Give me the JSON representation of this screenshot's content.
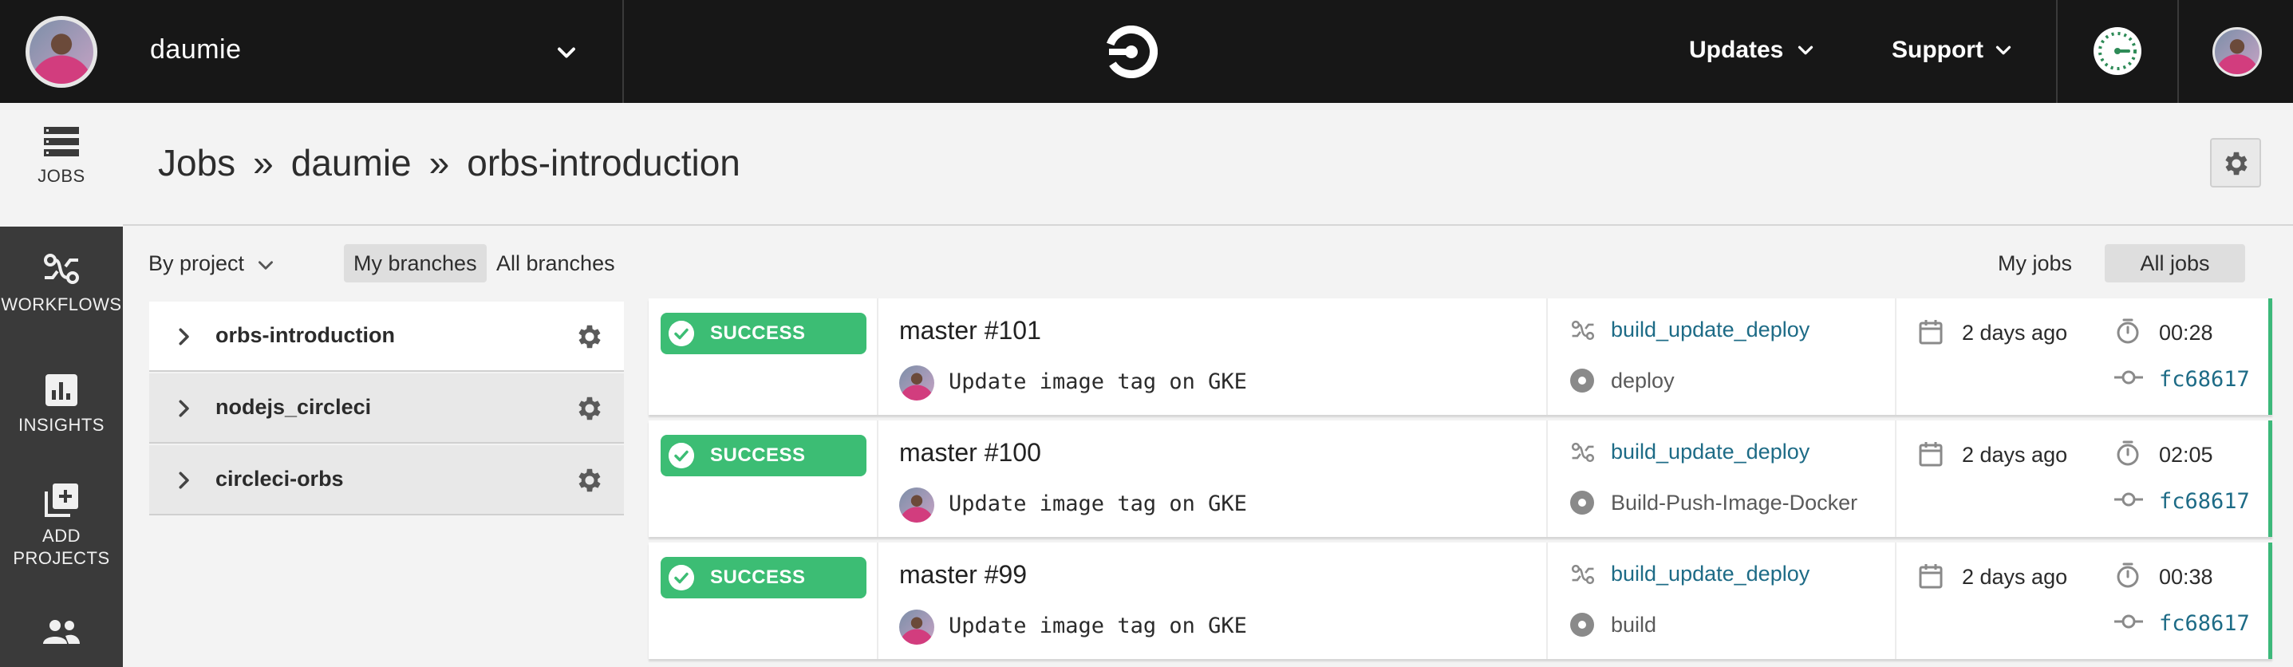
{
  "topbar": {
    "org_name": "daumie",
    "updates_label": "Updates",
    "support_label": "Support"
  },
  "sidebar": {
    "items": [
      {
        "label": "JOBS",
        "icon": "jobs-icon",
        "active": true
      },
      {
        "label": "WORKFLOWS",
        "icon": "workflows-icon",
        "active": false
      },
      {
        "label": "INSIGHTS",
        "icon": "insights-icon",
        "active": false
      },
      {
        "label_line1": "ADD",
        "label_line2": "PROJECTS",
        "icon": "add-projects-icon",
        "active": false
      },
      {
        "label": "",
        "icon": "team-icon",
        "active": false
      }
    ]
  },
  "header": {
    "crumbs": [
      "Jobs",
      "daumie",
      "orbs-introduction"
    ],
    "separator": "»"
  },
  "filters": {
    "by_project": "By project",
    "my_branches": "My branches",
    "all_branches": "All branches",
    "my_jobs": "My jobs",
    "all_jobs": "All jobs"
  },
  "projects": [
    {
      "name": "orbs-introduction"
    },
    {
      "name": "nodejs_circleci"
    },
    {
      "name": "circleci-orbs"
    }
  ],
  "jobs": [
    {
      "status": "SUCCESS",
      "title": "master #101",
      "commit_msg": "Update image tag on GKE",
      "workflow": "build_update_deploy",
      "job": "deploy",
      "when": "2 days ago",
      "duration": "00:28",
      "sha": "fc68617"
    },
    {
      "status": "SUCCESS",
      "title": "master #100",
      "commit_msg": "Update image tag on GKE",
      "workflow": "build_update_deploy",
      "job": "Build-Push-Image-Docker",
      "when": "2 days ago",
      "duration": "02:05",
      "sha": "fc68617"
    },
    {
      "status": "SUCCESS",
      "title": "master #99",
      "commit_msg": "Update image tag on GKE",
      "workflow": "build_update_deploy",
      "job": "build",
      "when": "2 days ago",
      "duration": "00:38",
      "sha": "fc68617"
    }
  ],
  "colors": {
    "topbar": "#171717",
    "sidebar": "#3a3a3a",
    "success": "#3cbd74",
    "link": "#1d6b86"
  }
}
